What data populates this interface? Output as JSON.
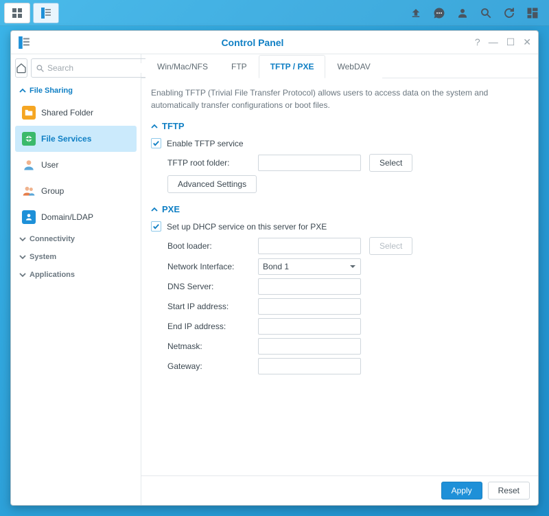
{
  "window": {
    "title": "Control Panel"
  },
  "search": {
    "placeholder": "Search"
  },
  "sidebar": {
    "categories": {
      "file_sharing": {
        "label": "File Sharing",
        "expanded": true
      },
      "connectivity": {
        "label": "Connectivity",
        "expanded": false
      },
      "system": {
        "label": "System",
        "expanded": false
      },
      "applications": {
        "label": "Applications",
        "expanded": false
      }
    },
    "items": {
      "shared_folder": {
        "label": "Shared Folder"
      },
      "file_services": {
        "label": "File Services"
      },
      "user": {
        "label": "User"
      },
      "group": {
        "label": "Group"
      },
      "domain_ldap": {
        "label": "Domain/LDAP"
      }
    }
  },
  "tabs": {
    "win": "Win/Mac/NFS",
    "ftp": "FTP",
    "tftp": "TFTP / PXE",
    "webdav": "WebDAV"
  },
  "intro": "Enabling TFTP (Trivial File Transfer Protocol) allows users to access data on the system and automatically transfer configurations or boot files.",
  "tftp": {
    "heading": "TFTP",
    "enable_label": "Enable TFTP service",
    "root_label": "TFTP root folder:",
    "root_value": "",
    "select_btn": "Select",
    "advanced_btn": "Advanced Settings"
  },
  "pxe": {
    "heading": "PXE",
    "setup_label": "Set up DHCP service on this server for PXE",
    "boot_loader_label": "Boot loader:",
    "boot_loader_value": "",
    "select_btn": "Select",
    "netif_label": "Network Interface:",
    "netif_value": "Bond 1",
    "dns_label": "DNS Server:",
    "dns_value": "",
    "start_ip_label": "Start IP address:",
    "start_ip_value": "",
    "end_ip_label": "End IP address:",
    "end_ip_value": "",
    "netmask_label": "Netmask:",
    "netmask_value": "",
    "gateway_label": "Gateway:",
    "gateway_value": ""
  },
  "footer": {
    "apply": "Apply",
    "reset": "Reset"
  }
}
